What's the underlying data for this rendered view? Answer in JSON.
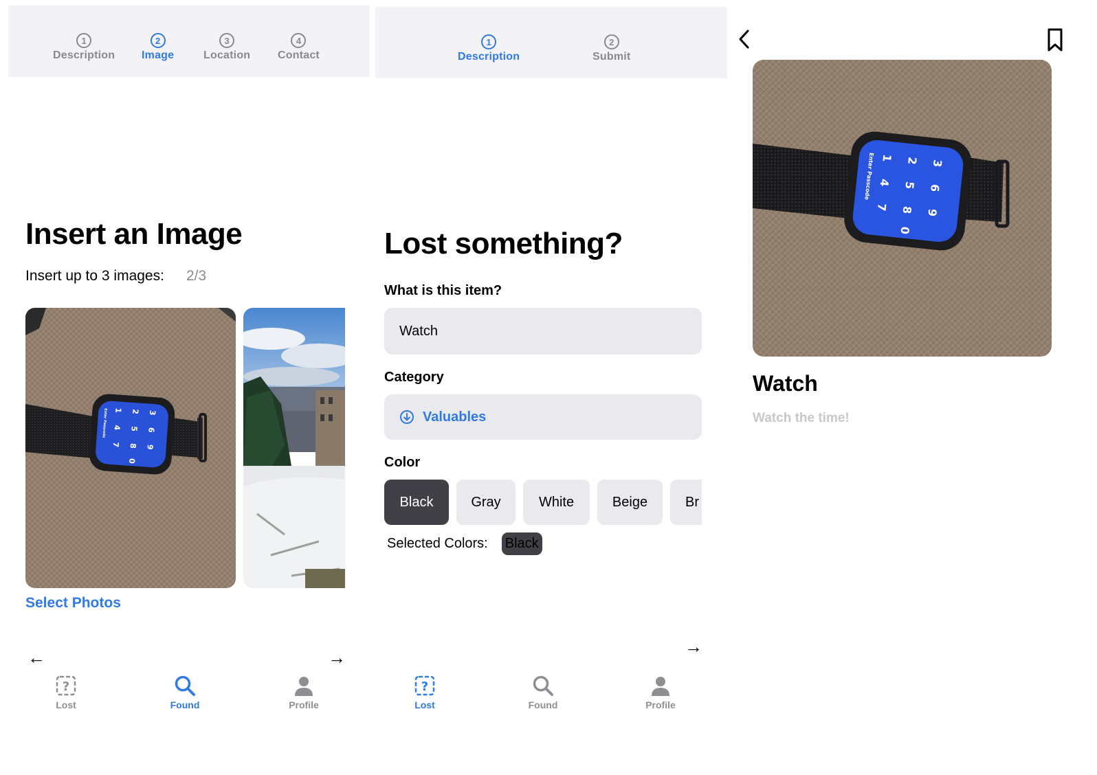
{
  "panel_image": {
    "steps": [
      {
        "num": "1",
        "label": "Description"
      },
      {
        "num": "2",
        "label": "Image"
      },
      {
        "num": "3",
        "label": "Location"
      },
      {
        "num": "4",
        "label": "Contact"
      }
    ],
    "title": "Insert an Image",
    "insert_label": "Insert up to 3 images:",
    "insert_count": "2/3",
    "select_photos": "Select Photos",
    "watch_screen": {
      "digits": [
        "3",
        "6",
        "9",
        "2",
        "5",
        "8",
        "1",
        "4",
        "7",
        "0"
      ],
      "caption": "Enter Passcode"
    },
    "back_arrow": "←",
    "next_arrow": "→",
    "tabs": [
      {
        "label": "Lost",
        "icon": "question-square-icon"
      },
      {
        "label": "Found",
        "icon": "magnifier-icon"
      },
      {
        "label": "Profile",
        "icon": "person-icon"
      }
    ]
  },
  "panel_lost": {
    "steps": [
      {
        "num": "1",
        "label": "Description"
      },
      {
        "num": "2",
        "label": "Submit"
      }
    ],
    "title": "Lost something?",
    "item_label": "What is this item?",
    "item_value": "Watch",
    "category_label": "Category",
    "category_value": "Valuables",
    "color_label": "Color",
    "colors": [
      "Black",
      "Gray",
      "White",
      "Beige",
      "Br"
    ],
    "selected_label": "Selected Colors:",
    "selected_value": "Black",
    "next_arrow": "→",
    "tabs": [
      {
        "label": "Lost",
        "icon": "question-square-icon"
      },
      {
        "label": "Found",
        "icon": "magnifier-icon"
      },
      {
        "label": "Profile",
        "icon": "person-icon"
      }
    ]
  },
  "panel_detail": {
    "title": "Watch",
    "subtitle": "Watch the time!",
    "watch_screen": {
      "digits": [
        "3",
        "6",
        "9",
        "2",
        "5",
        "8",
        "1",
        "4",
        "7",
        "0"
      ],
      "caption": "Enter Passcode"
    }
  },
  "colors": {
    "accent": "#2f7ae5",
    "inactive": "#8a8a8e",
    "stepbar_bg": "#f2f2f7",
    "field_bg": "#e9e9ee",
    "chip_selected": "#404046"
  }
}
